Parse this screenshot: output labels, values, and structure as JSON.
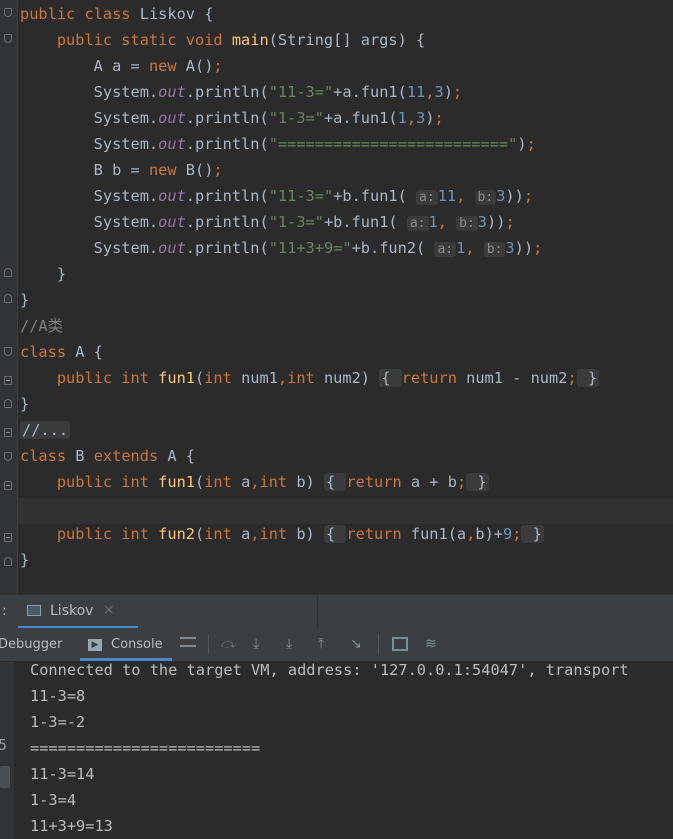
{
  "code_lines": [
    {
      "n": 0,
      "t": [
        [
          "kw",
          "public class "
        ],
        [
          "plain",
          "Liskov {"
        ]
      ]
    },
    {
      "n": 1,
      "t": [
        [
          "plain",
          "    "
        ],
        [
          "kw",
          "public static void "
        ],
        [
          "fn",
          "main"
        ],
        [
          "plain",
          "(String[] args) {"
        ]
      ]
    },
    {
      "n": 2,
      "t": [
        [
          "plain",
          "        A a = "
        ],
        [
          "kw",
          "new "
        ],
        [
          "plain",
          "A()"
        ],
        [
          "kw",
          ";"
        ]
      ]
    },
    {
      "n": 3,
      "t": [
        [
          "plain",
          "        System."
        ],
        [
          "st",
          "out"
        ],
        [
          "plain",
          ".println("
        ],
        [
          "str",
          "\"11-3=\""
        ],
        [
          "plain",
          "+a.fun1("
        ],
        [
          "num",
          "11"
        ],
        [
          "kw",
          ","
        ],
        [
          "num",
          "3"
        ],
        [
          "plain",
          ")"
        ],
        [
          "kw",
          ";"
        ]
      ]
    },
    {
      "n": 4,
      "t": [
        [
          "plain",
          "        System."
        ],
        [
          "st",
          "out"
        ],
        [
          "plain",
          ".println("
        ],
        [
          "str",
          "\"1-3=\""
        ],
        [
          "plain",
          "+a.fun1("
        ],
        [
          "num",
          "1"
        ],
        [
          "kw",
          ","
        ],
        [
          "num",
          "3"
        ],
        [
          "plain",
          ")"
        ],
        [
          "kw",
          ";"
        ]
      ]
    },
    {
      "n": 5,
      "t": [
        [
          "plain",
          "        System."
        ],
        [
          "st",
          "out"
        ],
        [
          "plain",
          ".println("
        ],
        [
          "str",
          "\"=========================\""
        ],
        [
          "plain",
          ")"
        ],
        [
          "kw",
          ";"
        ]
      ]
    },
    {
      "n": 6,
      "t": [
        [
          "plain",
          "        B b = "
        ],
        [
          "kw",
          "new "
        ],
        [
          "plain",
          "B()"
        ],
        [
          "kw",
          ";"
        ]
      ]
    },
    {
      "n": 7,
      "t": [
        [
          "plain",
          "        System."
        ],
        [
          "st",
          "out"
        ],
        [
          "plain",
          ".println("
        ],
        [
          "str",
          "\"11-3=\""
        ],
        [
          "plain",
          "+b.fun1( "
        ],
        [
          "hint",
          "a:"
        ],
        [
          "num",
          "11"
        ],
        [
          "kw",
          ", "
        ],
        [
          "hint",
          "b:"
        ],
        [
          "num",
          "3"
        ],
        [
          "plain",
          "))"
        ],
        [
          "kw",
          ";"
        ]
      ]
    },
    {
      "n": 8,
      "t": [
        [
          "plain",
          "        System."
        ],
        [
          "st",
          "out"
        ],
        [
          "plain",
          ".println("
        ],
        [
          "str",
          "\"1-3=\""
        ],
        [
          "plain",
          "+b.fun1( "
        ],
        [
          "hint",
          "a:"
        ],
        [
          "num",
          "1"
        ],
        [
          "kw",
          ", "
        ],
        [
          "hint",
          "b:"
        ],
        [
          "num",
          "3"
        ],
        [
          "plain",
          "))"
        ],
        [
          "kw",
          ";"
        ]
      ]
    },
    {
      "n": 9,
      "t": [
        [
          "plain",
          "        System."
        ],
        [
          "st",
          "out"
        ],
        [
          "plain",
          ".println("
        ],
        [
          "str",
          "\"11+3+9=\""
        ],
        [
          "plain",
          "+b.fun2( "
        ],
        [
          "hint",
          "a:"
        ],
        [
          "num",
          "1"
        ],
        [
          "kw",
          ", "
        ],
        [
          "hint",
          "b:"
        ],
        [
          "num",
          "3"
        ],
        [
          "plain",
          "))"
        ],
        [
          "kw",
          ";"
        ]
      ]
    },
    {
      "n": 10,
      "t": [
        [
          "plain",
          "    }"
        ]
      ]
    },
    {
      "n": 11,
      "t": [
        [
          "plain",
          "}"
        ]
      ]
    },
    {
      "n": 12,
      "t": [
        [
          "cm",
          "//A类"
        ]
      ]
    },
    {
      "n": 13,
      "t": [
        [
          "kw",
          "class "
        ],
        [
          "plain",
          "A {"
        ]
      ]
    },
    {
      "n": 14,
      "t": [
        [
          "plain",
          "    "
        ],
        [
          "kw",
          "public int "
        ],
        [
          "fn",
          "fun1"
        ],
        [
          "plain",
          "("
        ],
        [
          "kw",
          "int "
        ],
        [
          "plain",
          "num1"
        ],
        [
          "kw",
          ","
        ],
        [
          "kw",
          "int "
        ],
        [
          "plain",
          "num2) "
        ],
        [
          "coll",
          "{ "
        ],
        [
          "kw",
          "return "
        ],
        [
          "plain",
          "num1 - num2"
        ],
        [
          "kw",
          ";"
        ],
        [
          "coll",
          " }"
        ]
      ]
    },
    {
      "n": 15,
      "t": [
        [
          "plain",
          "}"
        ]
      ]
    },
    {
      "n": 16,
      "t": [
        [
          "coll",
          "//..."
        ]
      ]
    },
    {
      "n": 17,
      "t": [
        [
          "kw",
          "class "
        ],
        [
          "plain",
          "B "
        ],
        [
          "kw",
          "extends "
        ],
        [
          "plain",
          "A {"
        ]
      ]
    },
    {
      "n": 18,
      "t": [
        [
          "plain",
          "    "
        ],
        [
          "kw",
          "public int "
        ],
        [
          "fn",
          "fun1"
        ],
        [
          "plain",
          "("
        ],
        [
          "kw",
          "int "
        ],
        [
          "plain",
          "a"
        ],
        [
          "kw",
          ","
        ],
        [
          "kw",
          "int "
        ],
        [
          "plain",
          "b) "
        ],
        [
          "coll",
          "{ "
        ],
        [
          "kw",
          "return "
        ],
        [
          "plain",
          "a + b"
        ],
        [
          "kw",
          ";"
        ],
        [
          "coll",
          " }"
        ]
      ]
    },
    {
      "n": 19,
      "t": [
        [
          "plain",
          ""
        ]
      ]
    },
    {
      "n": 20,
      "t": [
        [
          "plain",
          "    "
        ],
        [
          "kw",
          "public int "
        ],
        [
          "fn",
          "fun2"
        ],
        [
          "plain",
          "("
        ],
        [
          "kw",
          "int "
        ],
        [
          "plain",
          "a"
        ],
        [
          "kw",
          ","
        ],
        [
          "kw",
          "int "
        ],
        [
          "plain",
          "b) "
        ],
        [
          "coll",
          "{ "
        ],
        [
          "kw",
          "return "
        ],
        [
          "plain",
          "fun1(a"
        ],
        [
          "kw",
          ","
        ],
        [
          "plain",
          "b)+"
        ],
        [
          "num",
          "9"
        ],
        [
          "kw",
          ";"
        ],
        [
          "coll",
          " }"
        ]
      ]
    },
    {
      "n": 21,
      "t": [
        [
          "plain",
          "}"
        ]
      ]
    }
  ],
  "tool_window": {
    "prefix": ":",
    "run_tab": "Liskov",
    "close_glyph": "×"
  },
  "toolbar": {
    "debugger": "Debugger",
    "console": "Console"
  },
  "console_lines": [
    "Connected to the target VM, address: '127.0.0.1:54047', transport",
    "11-3=8",
    "1-3=-2",
    "=========================",
    "11-3=14",
    "1-3=4",
    "11+3+9=13"
  ],
  "console_gutter_digit": "5",
  "colors": {
    "keyword": "#cc7832",
    "string": "#6a8759",
    "number": "#6897bb",
    "static_field": "#9876aa",
    "method": "#ffc66d",
    "comment": "#808080"
  }
}
